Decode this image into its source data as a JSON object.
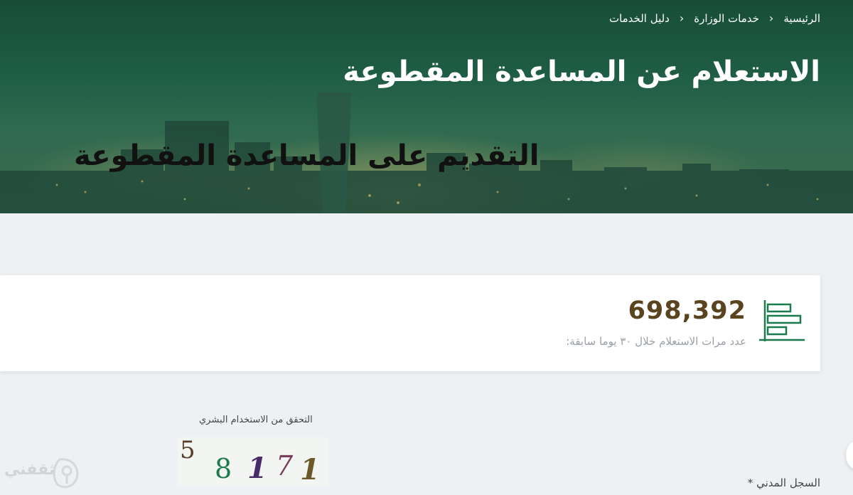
{
  "breadcrumb": {
    "home": "الرئيسية",
    "ministry_services": "خدمات الوزارة",
    "services_guide": "دليل الخدمات"
  },
  "page": {
    "title": "الاستعلام عن المساعدة المقطوعة",
    "overlay_title": "التقديم على المساعدة المقطوعة"
  },
  "stats": {
    "value": "698,392",
    "label": "عدد مرات الاستعلام خلال ٣٠ يوما سابقة:",
    "icon": "bar-chart-icon",
    "accent_color": "#1d7a4c",
    "value_color": "#5a4420"
  },
  "captcha": {
    "label": "التحقق من الاستخدام البشري",
    "chars": [
      "5",
      "8",
      "1",
      "7",
      "1"
    ]
  },
  "form": {
    "civil_registry_label": "السجل المدني *"
  },
  "watermark": {
    "text": "ثقفني"
  },
  "colors": {
    "hero_green": "#1f5d45",
    "background": "#eef1f4"
  }
}
